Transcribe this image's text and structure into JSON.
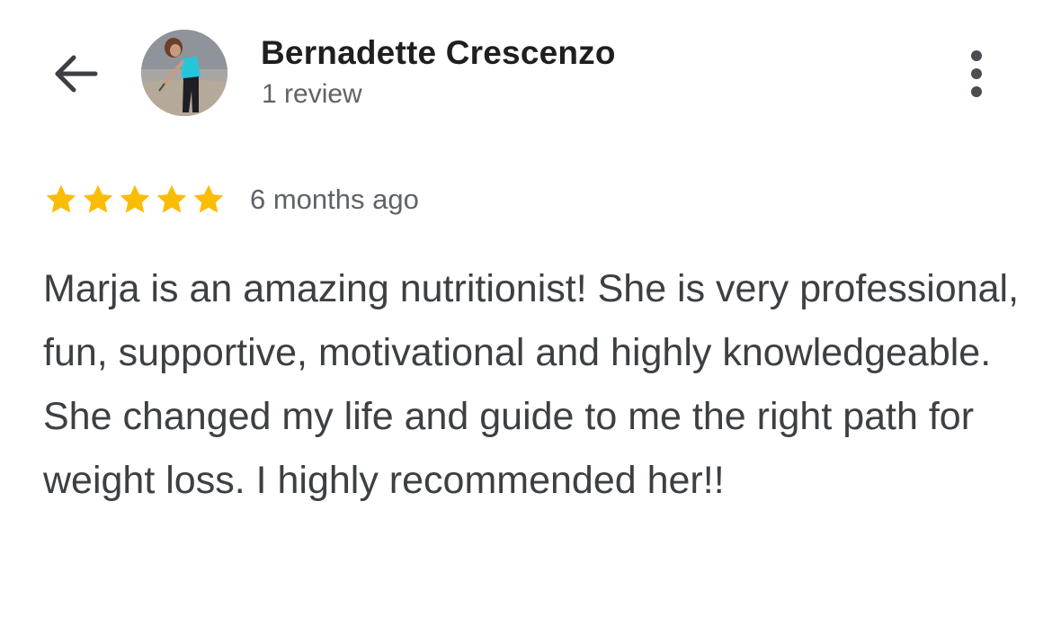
{
  "header": {
    "back_icon": "arrow-left-icon",
    "reviewer_name": "Bernadette Crescenzo",
    "review_count": "1 review",
    "more_icon": "more-vert-icon"
  },
  "review": {
    "rating": 5,
    "rating_max": 5,
    "star_color": "#fbbc04",
    "date": "6 months ago",
    "text": "Marja is an amazing nutritionist! She is very professional, fun, supportive, motivational and highly knowledgeable. She changed my life and guide to me the right path for weight loss. I highly recommended her!!"
  }
}
